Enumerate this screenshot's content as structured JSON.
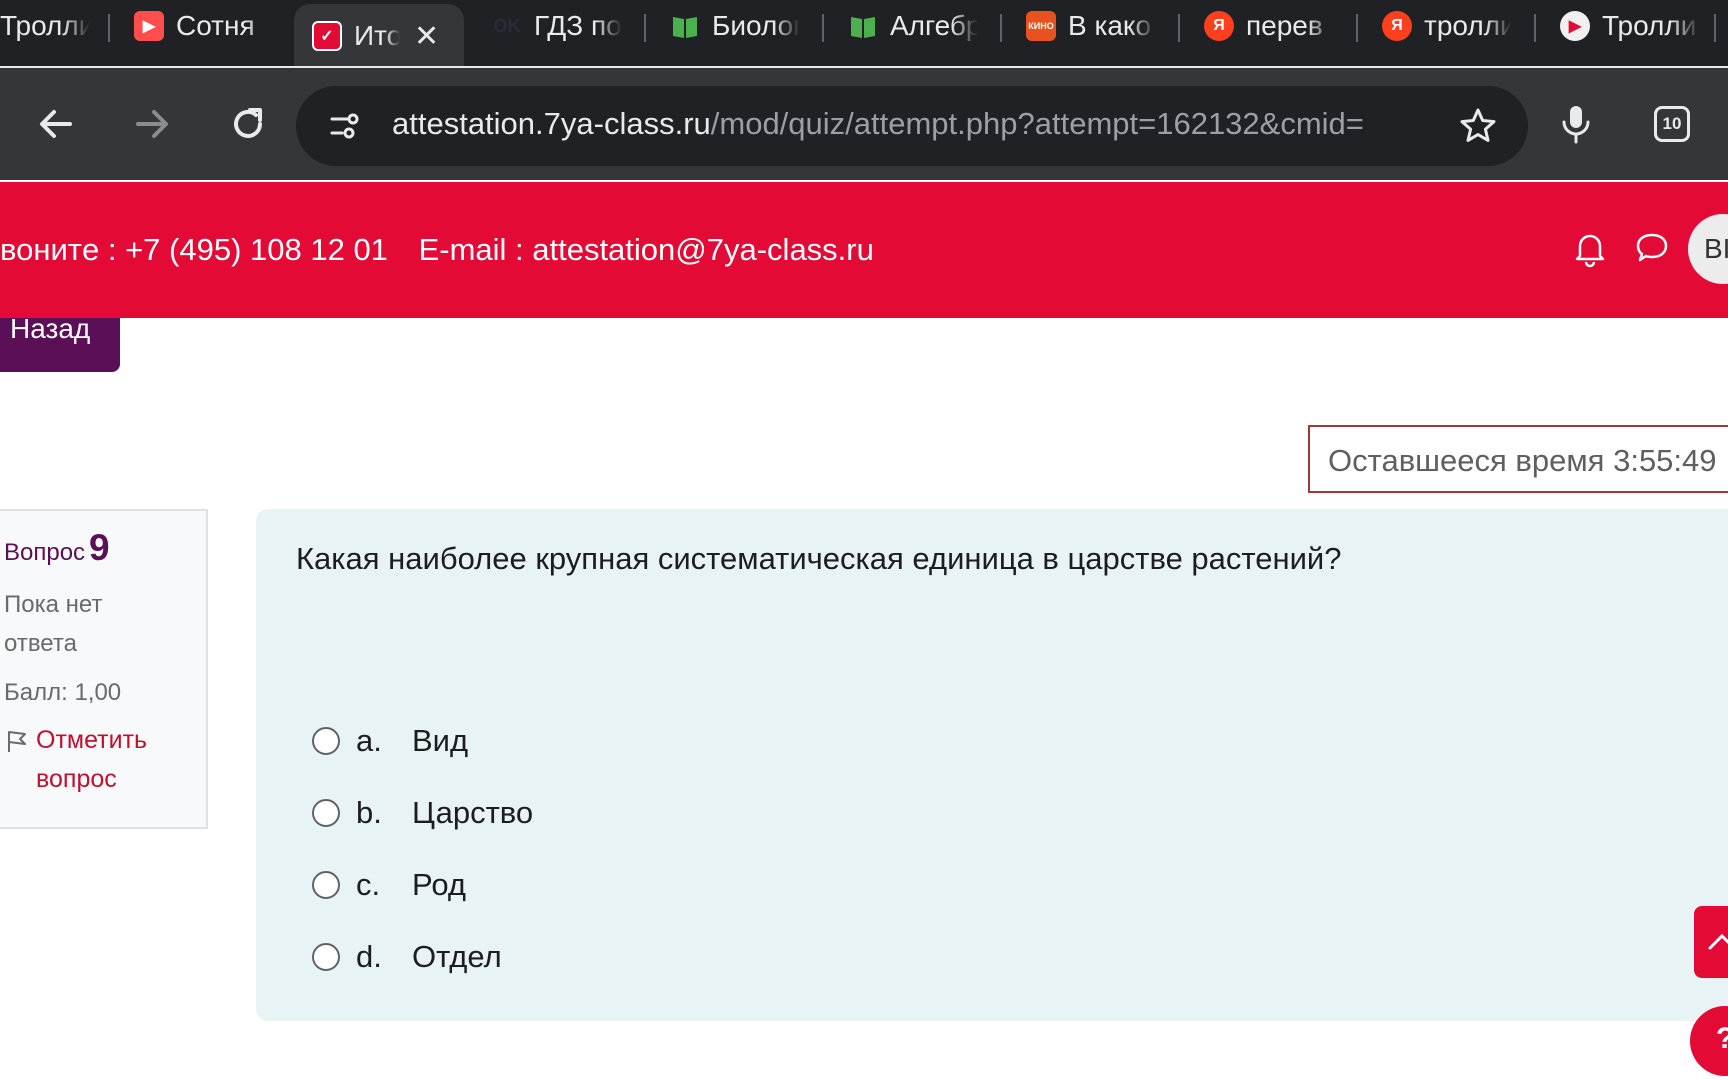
{
  "browser": {
    "tabs": [
      {
        "label": "Тролли",
        "favicon": "youtube-icon"
      },
      {
        "label": "Сотня",
        "favicon": "video-play-icon"
      },
      {
        "label": "Итог",
        "favicon": "quiz-site-icon",
        "active": true
      },
      {
        "label": "ГДЗ по",
        "favicon": "ok-icon"
      },
      {
        "label": "Биолог",
        "favicon": "book-icon"
      },
      {
        "label": "Алгебр",
        "favicon": "book-icon"
      },
      {
        "label": "В како",
        "favicon": "kinoafisha-icon"
      },
      {
        "label": "перев",
        "favicon": "yandex-icon"
      },
      {
        "label": "тролли",
        "favicon": "yandex-icon"
      },
      {
        "label": "Тролли",
        "favicon": "youtube-icon"
      }
    ],
    "url_host": "attestation.7ya-class.ru",
    "url_path": "/mod/quiz/attempt.php?attempt=162132&cmid=",
    "tab_count": "10"
  },
  "header": {
    "phone": "вонитe : +7 (495) 108 12 01",
    "email": "E-mail : attestation@7ya-class.ru",
    "avatar_initials": "ВІ",
    "bg_color": "#e30a35"
  },
  "page": {
    "back_label": "Назад",
    "timer_label": "Оставшееся время 3:55:49"
  },
  "question_info": {
    "label": "Вопрос",
    "number": "9",
    "state": "Пока нет ответа",
    "grade": "Балл: 1,00",
    "flag_label": "Отметить вопрос"
  },
  "question": {
    "text": "Какая наиболее крупная систематическая единица в царстве растений?",
    "answers": [
      {
        "letter": "a.",
        "text": "Вид"
      },
      {
        "letter": "b.",
        "text": "Царство"
      },
      {
        "letter": "c.",
        "text": "Род"
      },
      {
        "letter": "d.",
        "text": "Отдел"
      }
    ]
  }
}
